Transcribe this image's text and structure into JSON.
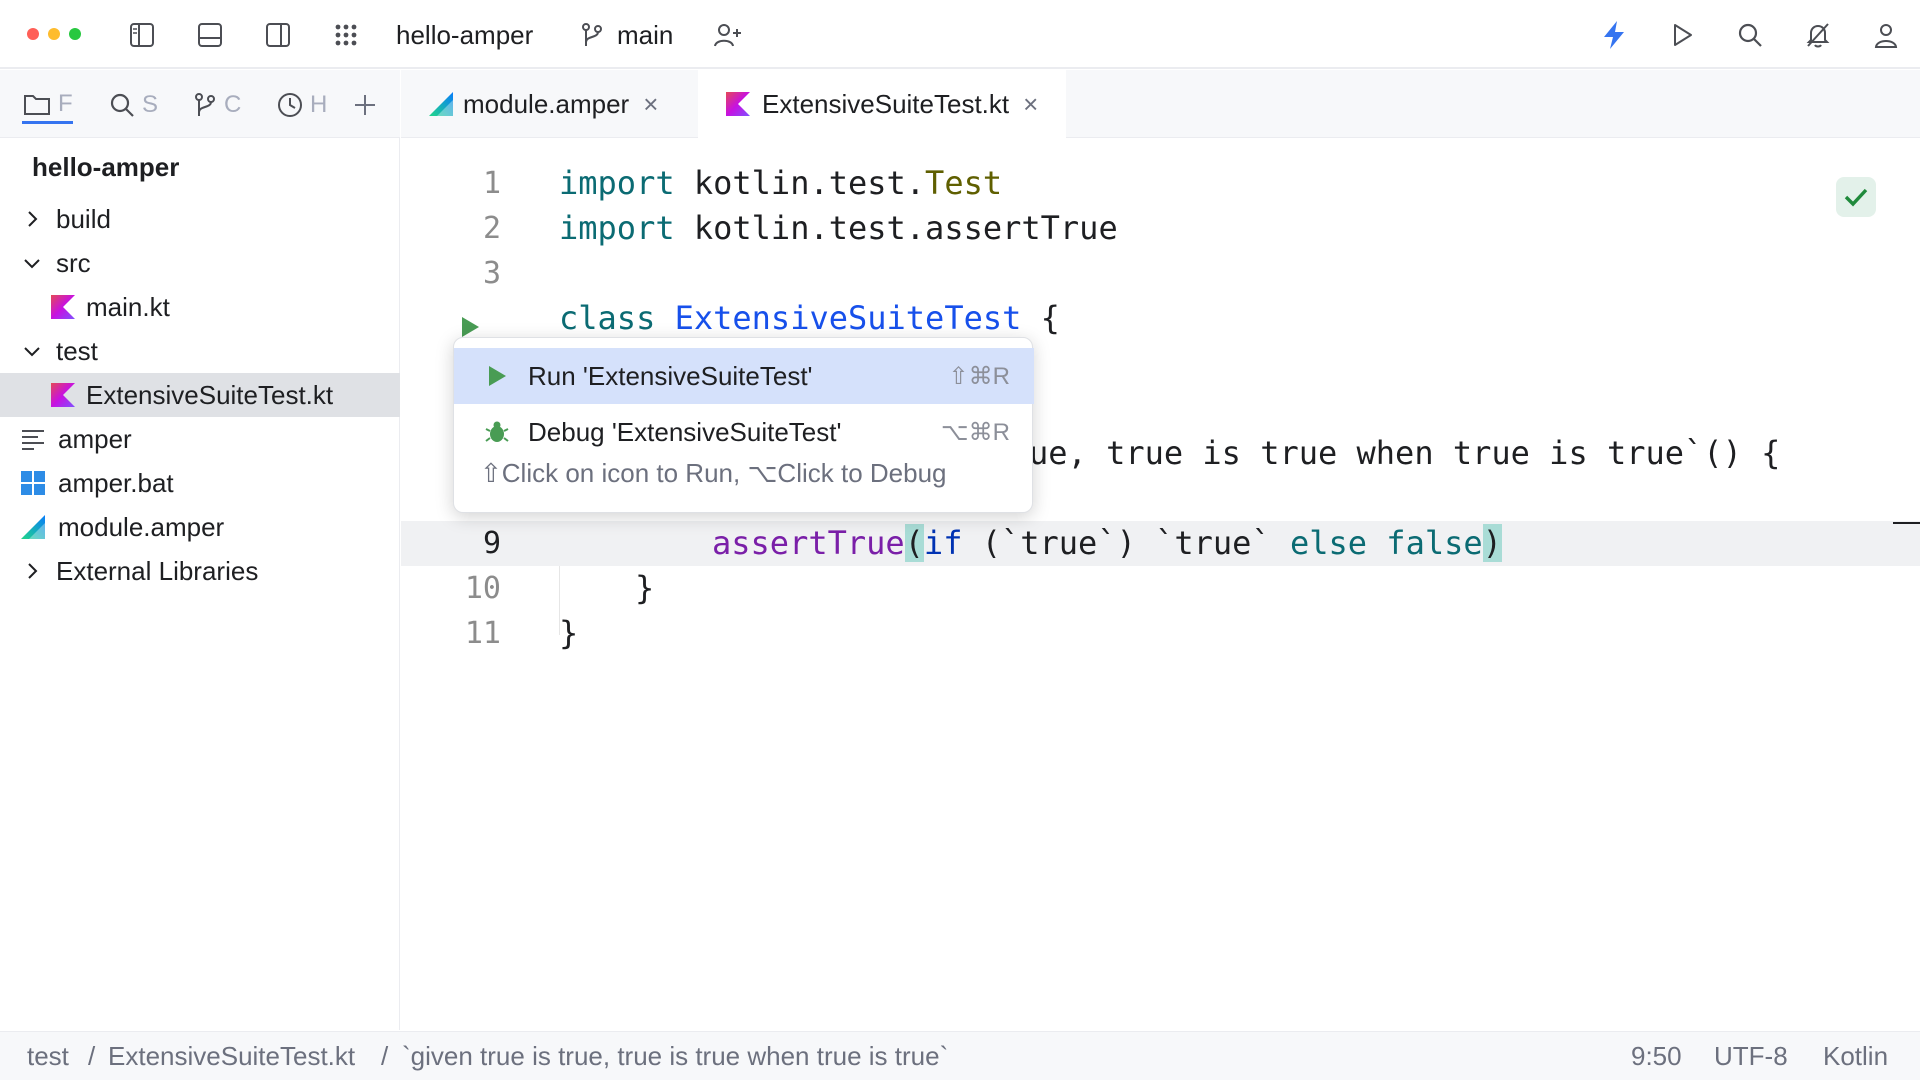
{
  "titlebar": {
    "project": "hello-amper",
    "branch": "main",
    "icons": [
      "project-panel-icon",
      "bottom-panel-icon",
      "right-panel-icon",
      "apps-grid-icon",
      "branch-icon",
      "add-user-icon",
      "lightning-icon",
      "run-icon",
      "search-icon",
      "notifications-off-icon",
      "account-icon"
    ],
    "traffic_colors": [
      "#ff5f57",
      "#febc2e",
      "#28c840"
    ]
  },
  "left_tabs": [
    {
      "label": "F",
      "icon": "folder-icon"
    },
    {
      "label": "S",
      "icon": "search-icon"
    },
    {
      "label": "C",
      "icon": "commit-icon"
    },
    {
      "label": "H",
      "icon": "history-icon"
    },
    {
      "label": "+",
      "icon": "plus-icon"
    }
  ],
  "project_tree": {
    "root": "hello-amper",
    "items": [
      {
        "label": "build",
        "icon": "chevron-right-icon"
      },
      {
        "label": "src",
        "icon": "chevron-down-icon"
      },
      {
        "label": "main.kt",
        "icon": "kotlin-file-icon"
      },
      {
        "label": "test",
        "icon": "chevron-down-icon"
      },
      {
        "label": "ExtensiveSuiteTest.kt",
        "icon": "kotlin-file-icon"
      },
      {
        "label": "amper",
        "icon": "text-file-icon"
      },
      {
        "label": "amper.bat",
        "icon": "windows-file-icon"
      },
      {
        "label": "module.amper",
        "icon": "amper-file-icon"
      },
      {
        "label": "External Libraries",
        "icon": "chevron-right-icon"
      }
    ]
  },
  "editor_tabs": [
    {
      "label": "module.amper",
      "close": "×"
    },
    {
      "label": "ExtensiveSuiteTest.kt",
      "close": "×"
    }
  ],
  "editor": {
    "line_numbers": [
      "1",
      "2",
      "3",
      "9",
      "10",
      "11"
    ],
    "code": {
      "l1_kw": "import",
      "l1_pkg": " kotlin.test.",
      "l1_type": "Test",
      "l2_kw": "import",
      "l2_rest": " kotlin.test.assertTrue",
      "l4_kw": "class",
      "l4_sp": " ",
      "l4_cls": "ExtensiveSuiteTest",
      "l4_brace": " {",
      "l7_visible": "ue, true is true when true is true`() {",
      "l9_fn": "assertTrue",
      "l9_paren_open": "(",
      "l9_if": "if",
      "l9_mid": " (`true`) `true` ",
      "l9_else": "else",
      "l9_sp": " ",
      "l9_false": "false",
      "l9_paren_close": ")",
      "l10": "}",
      "l11": "}"
    }
  },
  "popup": {
    "run_label": "Run 'ExtensiveSuiteTest'",
    "run_shortcut": "⇧⌘R",
    "debug_label": "Debug 'ExtensiveSuiteTest'",
    "debug_shortcut": "⌥⌘R",
    "hint": "⇧Click on icon to Run, ⌥Click to Debug"
  },
  "statusbar": {
    "crumb1": "test",
    "sep1": "/",
    "crumb2": "ExtensiveSuiteTest.kt",
    "sep2": "/",
    "crumb3": "`given true is true, true is true when true is true`",
    "position": "9:50",
    "encoding": "UTF-8",
    "language": "Kotlin"
  }
}
